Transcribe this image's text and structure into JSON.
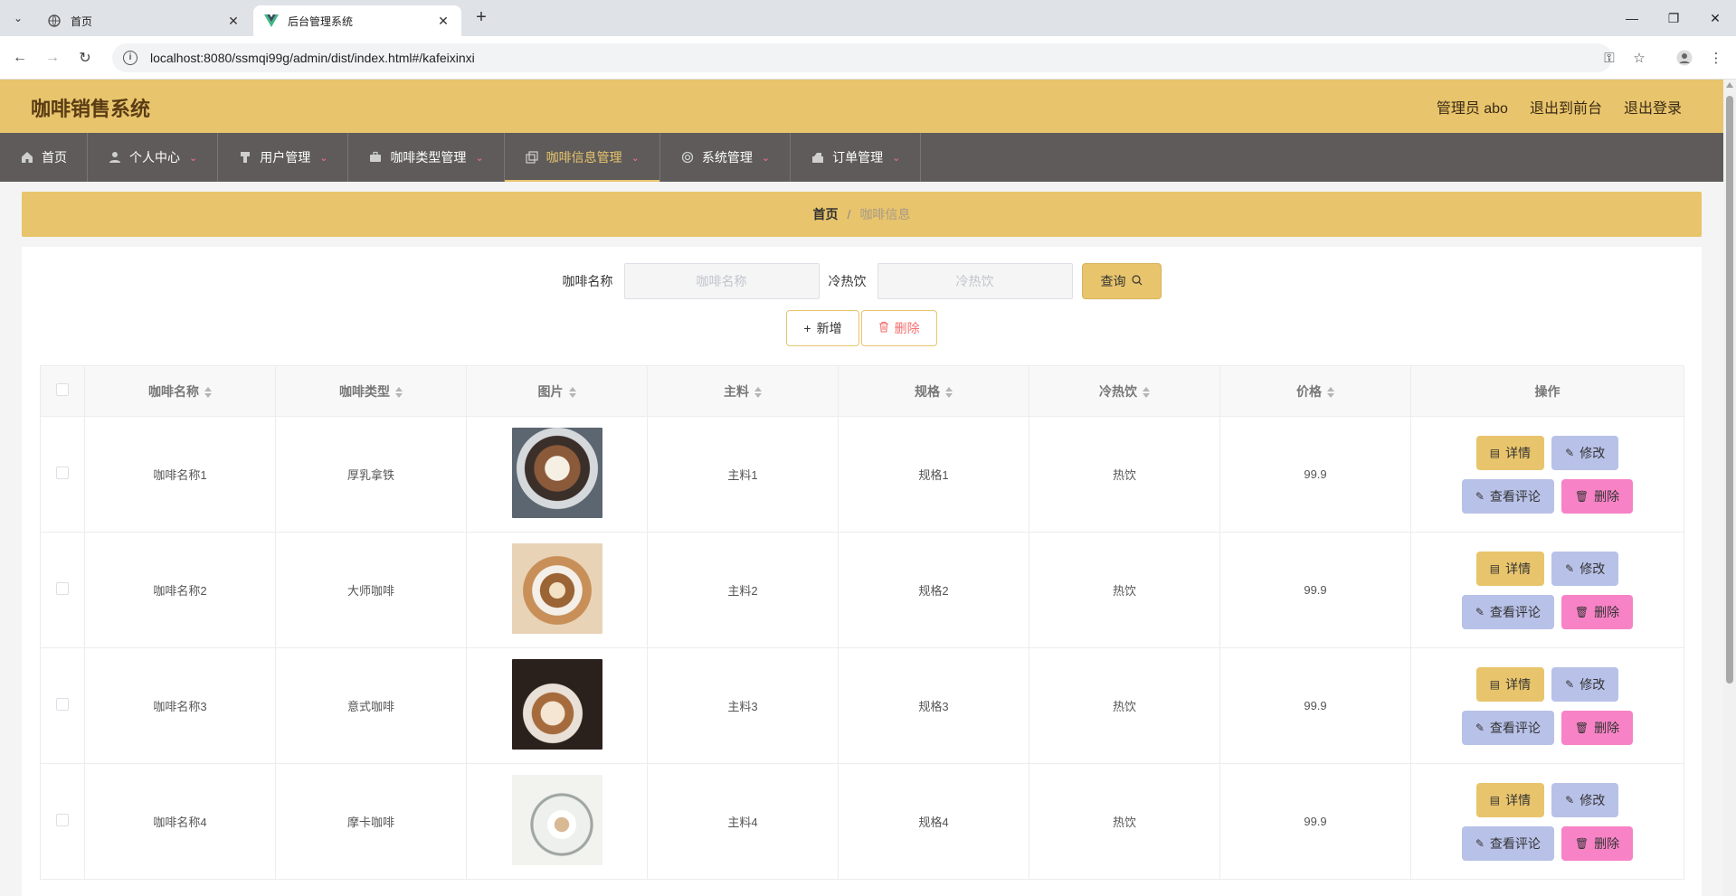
{
  "browser": {
    "tabs": [
      {
        "title": "首页",
        "active": false
      },
      {
        "title": "后台管理系统",
        "active": true
      }
    ],
    "url": "localhost:8080/ssmqi99g/admin/dist/index.html#/kafeixinxi"
  },
  "header": {
    "app_title": "咖啡销售系统",
    "user": "管理员 abo",
    "back_to_front": "退出到前台",
    "logout": "退出登录"
  },
  "nav": {
    "items": [
      {
        "label": "首页",
        "icon": "home-icon",
        "has_caret": false
      },
      {
        "label": "个人中心",
        "icon": "user-icon",
        "has_caret": true
      },
      {
        "label": "用户管理",
        "icon": "pin-icon",
        "has_caret": true
      },
      {
        "label": "咖啡类型管理",
        "icon": "briefcase-icon",
        "has_caret": true
      },
      {
        "label": "咖啡信息管理",
        "icon": "copy-icon",
        "has_caret": true,
        "active": true
      },
      {
        "label": "系统管理",
        "icon": "system-icon",
        "has_caret": true
      },
      {
        "label": "订单管理",
        "icon": "order-icon",
        "has_caret": true
      }
    ]
  },
  "breadcrumb": {
    "home": "首页",
    "separator": "/",
    "current": "咖啡信息"
  },
  "search": {
    "name_label": "咖啡名称",
    "name_placeholder": "咖啡名称",
    "name_value": "",
    "temp_label": "冷热饮",
    "temp_placeholder": "冷热饮",
    "temp_value": "",
    "query_label": "查询"
  },
  "actions": {
    "add_label": "新增",
    "delete_label": "删除"
  },
  "table": {
    "headers": {
      "name": "咖啡名称",
      "type": "咖啡类型",
      "image": "图片",
      "main": "主料",
      "spec": "规格",
      "temp": "冷热饮",
      "price": "价格",
      "ops": "操作"
    },
    "rows": [
      {
        "name": "咖啡名称1",
        "type": "厚乳拿铁",
        "main": "主料1",
        "spec": "规格1",
        "temp": "热饮",
        "price": "99.9"
      },
      {
        "name": "咖啡名称2",
        "type": "大师咖啡",
        "main": "主料2",
        "spec": "规格2",
        "temp": "热饮",
        "price": "99.9"
      },
      {
        "name": "咖啡名称3",
        "type": "意式咖啡",
        "main": "主料3",
        "spec": "规格3",
        "temp": "热饮",
        "price": "99.9"
      },
      {
        "name": "咖啡名称4",
        "type": "摩卡咖啡",
        "main": "主料4",
        "spec": "规格4",
        "temp": "热饮",
        "price": "99.9"
      }
    ],
    "op_labels": {
      "detail": "详情",
      "edit": "修改",
      "review": "查看评论",
      "delete": "删除"
    }
  },
  "colors": {
    "header_bg": "#e8c46c",
    "nav_bg": "#5e5b5a",
    "detail_btn": "#e8c46c",
    "edit_btn": "#b8c1e8",
    "delete_btn": "#f783c6"
  }
}
